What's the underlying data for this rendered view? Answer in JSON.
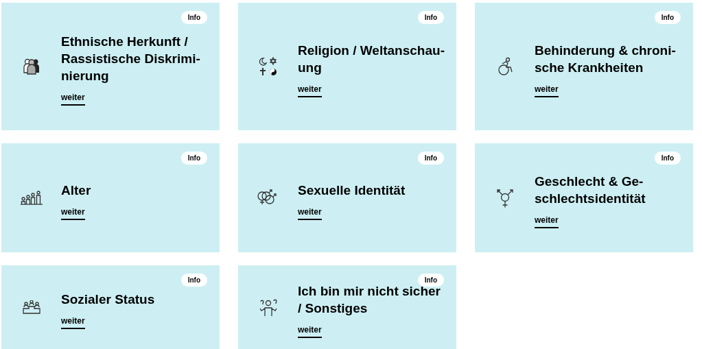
{
  "cards": [
    {
      "kind": "people",
      "title_lines": [
        "Ethnische Herkunft /",
        "Rassistische Diskrimi-",
        "nierung"
      ],
      "badge": "Info",
      "link": "weiter"
    },
    {
      "kind": "religion",
      "title_lines": [
        "Religion / Weltanschau-",
        "ung"
      ],
      "badge": "Info",
      "link": "weiter"
    },
    {
      "kind": "wheelchair",
      "title_lines": [
        "Behinderung & chroni-",
        "sche Krankheiten"
      ],
      "badge": "Info",
      "link": "weiter"
    },
    {
      "kind": "ages",
      "title_lines": [
        "Alter"
      ],
      "badge": "Info",
      "link": "weiter"
    },
    {
      "kind": "rings",
      "title_lines": [
        "Sexuelle Identität"
      ],
      "badge": "Info",
      "link": "weiter"
    },
    {
      "kind": "gender",
      "title_lines": [
        "Geschlecht & Ge-",
        "schlechtsidentität"
      ],
      "badge": "Info",
      "link": "weiter"
    },
    {
      "kind": "podium",
      "title_lines": [
        "Sozialer Status"
      ],
      "badge": "Info",
      "link": "weiter"
    },
    {
      "kind": "unsure",
      "title_lines": [
        "Ich bin mir nicht sicher",
        "/ Sonstiges"
      ],
      "badge": "Info",
      "link": "weiter"
    }
  ]
}
